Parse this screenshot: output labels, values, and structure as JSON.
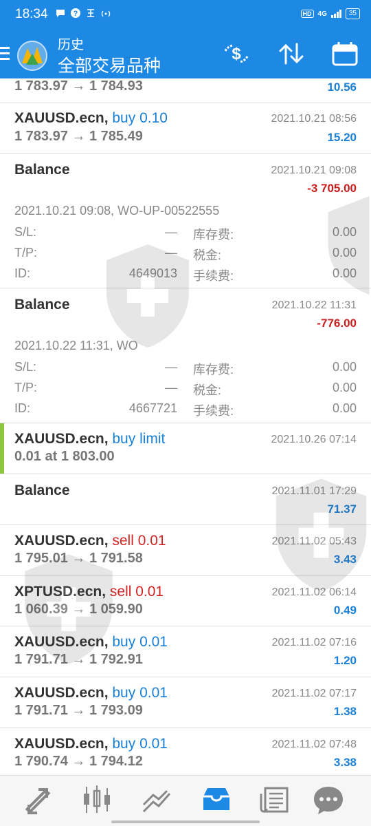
{
  "status_bar": {
    "time": "18:34",
    "network": "4G",
    "battery": "35",
    "hd": "HD"
  },
  "header": {
    "title": "历史",
    "subtitle": "全部交易品种",
    "icons": [
      "menu-icon",
      "metatrader-logo",
      "currency-exchange-icon",
      "sort-icon",
      "calendar-icon"
    ]
  },
  "colors": {
    "header_bg": "#1d89e4",
    "buy": "#1a7fd6",
    "sell": "#d22323",
    "positive": "#1a7fd6",
    "negative": "#c81e1e",
    "pending_marker": "#8dc63f"
  },
  "rows": [
    {
      "type": "trade",
      "prices": "1 783.97 → 1 784.93",
      "profit": "10.56"
    },
    {
      "type": "trade",
      "symbol": "XAUUSD.ecn,",
      "side": "buy 0.10",
      "date": "2021.10.21 08:56",
      "prices": "1 783.97 → 1 785.49",
      "profit": "15.20"
    },
    {
      "type": "balance",
      "title": "Balance",
      "date": "2021.10.21 09:08",
      "amount": "-3 705.00",
      "comment": "2021.10.21 09:08, WO-UP-00522555",
      "sl_label": "S/L:",
      "sl": "—",
      "tp_label": "T/P:",
      "tp": "—",
      "id_label": "ID:",
      "id": "4649013",
      "swap_label": "库存费:",
      "swap": "0.00",
      "tax_label": "税金:",
      "tax": "0.00",
      "fee_label": "手续费:",
      "fee": "0.00"
    },
    {
      "type": "balance",
      "title": "Balance",
      "date": "2021.10.22 11:31",
      "amount": "-776.00",
      "comment": "2021.10.22 11:31, WO",
      "sl_label": "S/L:",
      "sl": "—",
      "tp_label": "T/P:",
      "tp": "—",
      "id_label": "ID:",
      "id": "4667721",
      "swap_label": "库存费:",
      "swap": "0.00",
      "tax_label": "税金:",
      "tax": "0.00",
      "fee_label": "手续费:",
      "fee": "0.00"
    },
    {
      "type": "order",
      "symbol": "XAUUSD.ecn,",
      "side": "buy limit",
      "date": "2021.10.26 07:14",
      "prices": "0.01 at 1 803.00"
    },
    {
      "type": "balance_short",
      "title": "Balance",
      "date": "2021.11.01 17:29",
      "amount": "71.37"
    },
    {
      "type": "trade",
      "symbol": "XAUUSD.ecn,",
      "side": "sell 0.01",
      "date": "2021.11.02 05:43",
      "prices": "1 795.01 → 1 791.58",
      "profit": "3.43"
    },
    {
      "type": "trade",
      "symbol": "XPTUSD.ecn,",
      "side": "sell 0.01",
      "date": "2021.11.02 06:14",
      "prices": "1 060.39 → 1 059.90",
      "profit": "0.49"
    },
    {
      "type": "trade",
      "symbol": "XAUUSD.ecn,",
      "side": "buy 0.01",
      "date": "2021.11.02 07:16",
      "prices": "1 791.71 → 1 792.91",
      "profit": "1.20"
    },
    {
      "type": "trade",
      "symbol": "XAUUSD.ecn,",
      "side": "buy 0.01",
      "date": "2021.11.02 07:17",
      "prices": "1 791.71 → 1 793.09",
      "profit": "1.38"
    },
    {
      "type": "trade",
      "symbol": "XAUUSD.ecn,",
      "side": "buy 0.01",
      "date": "2021.11.02 07:48",
      "prices": "1 790.74 → 1 794.12",
      "profit": "3.38"
    }
  ],
  "bottom_nav": {
    "items": [
      "quotes-icon",
      "chart-icon",
      "trade-icon",
      "history-icon",
      "news-icon",
      "chat-icon"
    ],
    "active": "history-icon"
  }
}
